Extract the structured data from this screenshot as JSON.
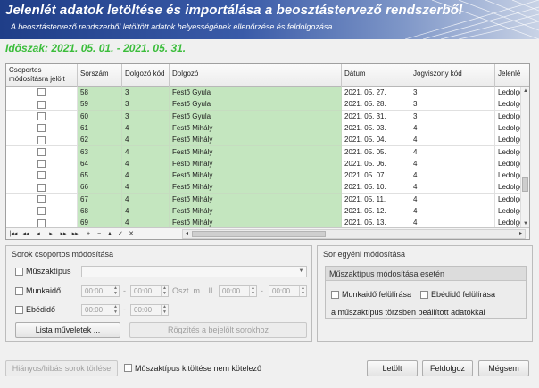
{
  "header": {
    "title": "Jelenlét adatok letöltése és importálása a beosztástervező rendszerből",
    "subtitle": "A beosztástervező rendszerből letöltött adatok helyességének ellenőrzése és feldolgozása."
  },
  "period": "Időszak: 2021. 05. 01. - 2021. 05. 31.",
  "grid": {
    "columns": [
      "Csoportos módosításra jelölt",
      "Sorszám",
      "Dolgozó kód",
      "Dolgozó",
      "Dátum",
      "Jogviszony kód",
      "Jelenlé"
    ],
    "rows": [
      {
        "sorszam": "58",
        "kod": "3",
        "dolgozo": "Festő Gyula",
        "datum": "2021. 05. 27.",
        "jogviszony": "3",
        "jelenlet": "Ledolgo"
      },
      {
        "sorszam": "59",
        "kod": "3",
        "dolgozo": "Festő Gyula",
        "datum": "2021. 05. 28.",
        "jogviszony": "3",
        "jelenlet": "Ledolgo"
      },
      {
        "sorszam": "60",
        "kod": "3",
        "dolgozo": "Festő Gyula",
        "datum": "2021. 05. 31.",
        "jogviszony": "3",
        "jelenlet": "Ledolgo"
      },
      {
        "sorszam": "61",
        "kod": "4",
        "dolgozo": "Festő Mihály",
        "datum": "2021. 05. 03.",
        "jogviszony": "4",
        "jelenlet": "Ledolgo"
      },
      {
        "sorszam": "62",
        "kod": "4",
        "dolgozo": "Festő Mihály",
        "datum": "2021. 05. 04.",
        "jogviszony": "4",
        "jelenlet": "Ledolgo"
      },
      {
        "sorszam": "63",
        "kod": "4",
        "dolgozo": "Festő Mihály",
        "datum": "2021. 05. 05.",
        "jogviszony": "4",
        "jelenlet": "Ledolgo"
      },
      {
        "sorszam": "64",
        "kod": "4",
        "dolgozo": "Festő Mihály",
        "datum": "2021. 05. 06.",
        "jogviszony": "4",
        "jelenlet": "Ledolgo"
      },
      {
        "sorszam": "65",
        "kod": "4",
        "dolgozo": "Festő Mihály",
        "datum": "2021. 05. 07.",
        "jogviszony": "4",
        "jelenlet": "Ledolgo"
      },
      {
        "sorszam": "66",
        "kod": "4",
        "dolgozo": "Festő Mihály",
        "datum": "2021. 05. 10.",
        "jogviszony": "4",
        "jelenlet": "Ledolgo"
      },
      {
        "sorszam": "67",
        "kod": "4",
        "dolgozo": "Festő Mihály",
        "datum": "2021. 05. 11.",
        "jogviszony": "4",
        "jelenlet": "Ledolgo"
      },
      {
        "sorszam": "68",
        "kod": "4",
        "dolgozo": "Festő Mihály",
        "datum": "2021. 05. 12.",
        "jogviszony": "4",
        "jelenlet": "Ledolgo"
      },
      {
        "sorszam": "69",
        "kod": "4",
        "dolgozo": "Festő Mihály",
        "datum": "2021. 05. 13.",
        "jogviszony": "4",
        "jelenlet": "Ledolgo"
      }
    ]
  },
  "sorok_group": {
    "title": "Sorok csoportos módosítása",
    "muszaktipus_label": "Műszaktípus",
    "munkaido_label": "Munkaidő",
    "ebedido_label": "Ebédidő",
    "time_from": "00:00",
    "time_to": "00:00",
    "oszt_label": "Oszt. m.i. II.",
    "dash": "-",
    "lista_button": "Lista műveletek ...",
    "rogzites_button": "Rögzítés a bejelölt sorokhoz"
  },
  "egyeni_group": {
    "title": "Sor egyéni módosítása",
    "inner_title": "Műszaktípus módosítása esetén",
    "munkaido_felul": "Munkaidő felülírása",
    "ebedido_felul": "Ebédidő felülírása",
    "note": "a műszaktípus törzsben beállított adatokkal"
  },
  "footer": {
    "torles_button": "Hiányos/hibás sorok törlése",
    "nem_kotelezo_label": "Műszaktípus kitöltése nem kötelező",
    "letolt_button": "Letölt",
    "feldolgoz_button": "Feldolgoz",
    "megsem_button": "Mégsem"
  },
  "colors": {
    "banner": "#1f3e88",
    "row_green": "#c4e6bf",
    "period_green": "#3bbd3b"
  }
}
